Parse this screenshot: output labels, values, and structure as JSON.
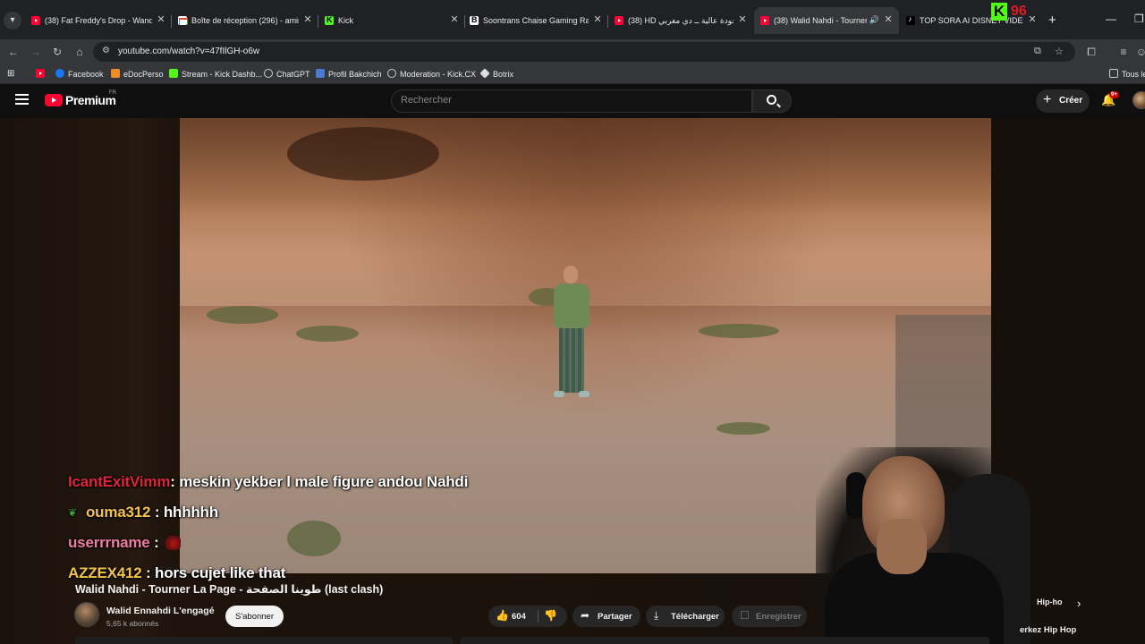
{
  "browser": {
    "tabs": [
      {
        "title": "(38) Fat Freddy's Drop - Wande",
        "favicon": "youtube-icon"
      },
      {
        "title": "Boîte de réception (296) - amin",
        "favicon": "gmail-icon"
      },
      {
        "title": "Kick",
        "favicon": "kick-icon"
      },
      {
        "title": "Soontrans Chaise Gaming Raci",
        "favicon": "doc-icon"
      },
      {
        "title": "(38) HD ــ بجودة عالية ــ دي مغربي",
        "favicon": "youtube-icon"
      },
      {
        "title": "(38) Walid Nahdi - Tourner",
        "favicon": "youtube-icon",
        "active": true,
        "audio": true
      },
      {
        "title": "TOP SORA AI DISNEY VIDEOS",
        "favicon": "tiktok-icon"
      }
    ],
    "overlay_kick_count": "96",
    "url": "youtube.com/watch?v=47fIlGH-o6w",
    "bookmarks": [
      "Facebook",
      "eDocPerso",
      "Stream - Kick Dashb...",
      "ChatGPT",
      "Profil Bakchich",
      "Moderation - Kick.CX",
      "Botrix"
    ],
    "bookmarks_all": "Tous le"
  },
  "youtube": {
    "brand": "Premium",
    "country": "FR",
    "search_placeholder": "Rechercher",
    "create_label": "Créer",
    "notifications": "9+",
    "video_title": "Walid Nahdi - Tourner La Page - طوينا الصفحة (last clash)",
    "channel_name": "Walid Ennahdi L'engagé",
    "subscribers": "5,65 k abonnés",
    "subscribe_label": "S'abonner",
    "likes": "604",
    "share_label": "Partager",
    "download_label": "Télécharger",
    "save_label": "Enregistrer",
    "related_chip": "Hip-ho",
    "related_chip2": "erkez Hip Hop"
  },
  "chat": [
    {
      "user": "IcantExitVimm",
      "color": "#e0243a",
      "message": ": meskin yekber l male figure andou Nahdi"
    },
    {
      "user": "ouma312",
      "color": "#f4c44a",
      "message": " : hhhhhh",
      "badge": "leaf-icon"
    },
    {
      "user": "userrrname",
      "color": "#f07ca6",
      "message": " :",
      "emote": "emote-icon"
    },
    {
      "user": "AZZEX412",
      "color": "#f4c44a",
      "message": " : hors cujet like that"
    }
  ],
  "colors": {
    "chrome_tabstrip": "#202124",
    "chrome_toolbar": "#35363a",
    "youtube_bg": "#0f0f0f",
    "youtube_red": "#ff0033",
    "kick_green": "#53fc18"
  }
}
